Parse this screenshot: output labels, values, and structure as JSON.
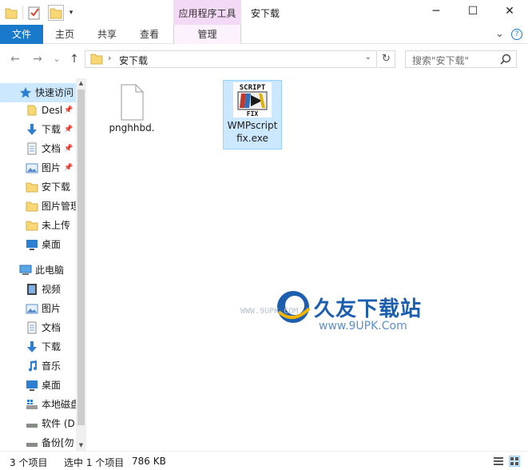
{
  "window": {
    "title": "安下载",
    "context_tab_group": "应用程序工具",
    "minimize_glyph": "─",
    "maximize_glyph": "☐",
    "close_glyph": "✕"
  },
  "ribbon": {
    "file_tab": "文件",
    "tabs": [
      "主页",
      "共享",
      "查看"
    ],
    "manage_tab": "管理",
    "collapse_glyph": "⌄",
    "help_glyph": "?"
  },
  "navigation": {
    "back_glyph": "←",
    "forward_glyph": "→",
    "recent_glyph": "⌄",
    "up_glyph": "↑",
    "address_path": "安下载",
    "refresh_glyph": "↻",
    "search_placeholder": "搜索\"安下载\""
  },
  "nav_pane": {
    "quick_access_label": "快速访问",
    "quick_items": [
      {
        "label": "Desl",
        "icon": "desktop-folder-icon",
        "pinned": true
      },
      {
        "label": "下载",
        "icon": "download-icon",
        "pinned": true
      },
      {
        "label": "文档",
        "icon": "document-icon",
        "pinned": true
      },
      {
        "label": "图片",
        "icon": "pictures-icon",
        "pinned": true
      },
      {
        "label": "安下载",
        "icon": "folder-icon",
        "pinned": false
      },
      {
        "label": "图片管理",
        "icon": "folder-icon",
        "pinned": false
      },
      {
        "label": "未上传",
        "icon": "folder-icon",
        "pinned": false
      },
      {
        "label": "桌面",
        "icon": "desktop-icon",
        "pinned": false
      }
    ],
    "this_pc_label": "此电脑",
    "pc_items": [
      {
        "label": "视频",
        "icon": "video-icon"
      },
      {
        "label": "图片",
        "icon": "pictures-icon"
      },
      {
        "label": "文档",
        "icon": "document-icon"
      },
      {
        "label": "下载",
        "icon": "download-icon"
      },
      {
        "label": "音乐",
        "icon": "music-icon"
      },
      {
        "label": "桌面",
        "icon": "desktop-icon"
      },
      {
        "label": "本地磁盘",
        "icon": "system-drive-icon"
      },
      {
        "label": "软件 (D",
        "icon": "drive-icon"
      },
      {
        "label": "备份[勿",
        "icon": "drive-icon"
      }
    ]
  },
  "files": [
    {
      "name": "pnghhbd.",
      "icon": "blank-file-icon",
      "selected": false
    },
    {
      "name": "WMPscriptfix.exe",
      "icon": "wmp-scriptfix-app-icon",
      "selected": true,
      "icon_text": [
        "SCRIPT",
        "FIX"
      ]
    }
  ],
  "watermark": {
    "brand": "久友下载站",
    "url_left": "WWW.9UPK.COM",
    "url": "www.9UPK.Com"
  },
  "status": {
    "item_count": "3 个项目",
    "selection": "选中 1 个项目",
    "size": "786 KB"
  },
  "colors": {
    "accent": "#1979ca",
    "context_tab": "#f4d9f6",
    "selection": "#cce8ff",
    "folder": "#f8d775"
  }
}
